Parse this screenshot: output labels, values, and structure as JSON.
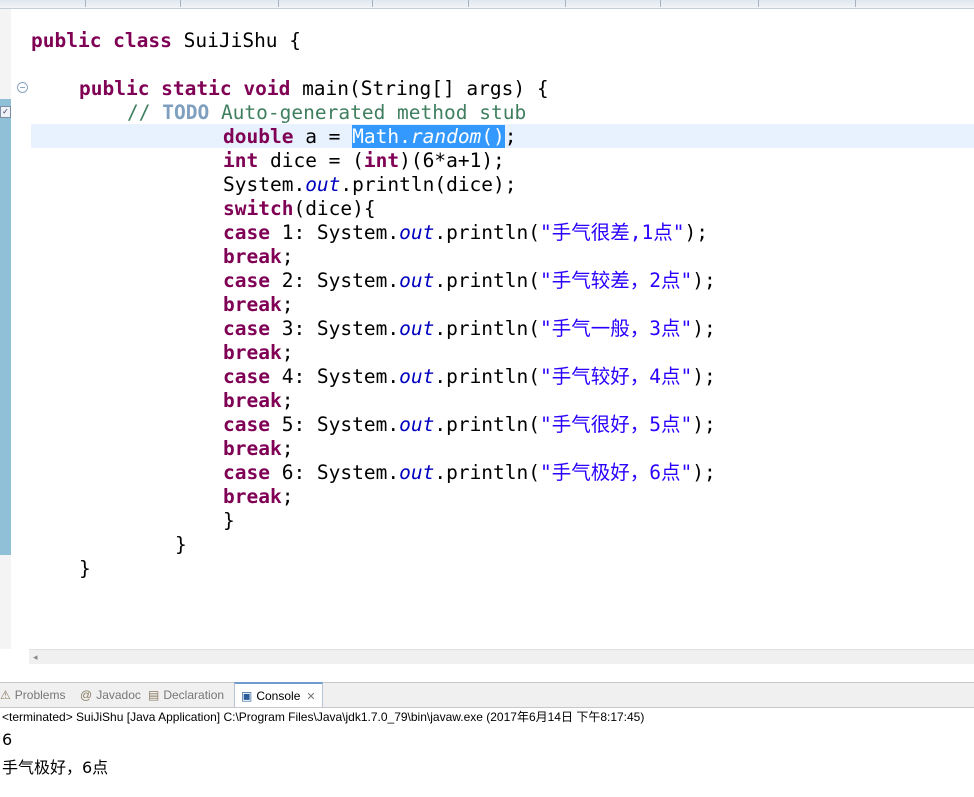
{
  "code": {
    "class_decl": {
      "kw": "public class",
      "rest": " SuiJiShu {"
    },
    "main_decl": {
      "kw": "public static void",
      "rest": " main(String[] args) {"
    },
    "comment": {
      "prefix": "// ",
      "todo": "TODO",
      "rest": " Auto-generated method stub"
    },
    "line_a": {
      "kw": "double",
      "mid": " a = ",
      "sel_a": "Math.",
      "sel_b": "random",
      "sel_c": "()",
      "end": ";"
    },
    "line_dice": {
      "kw": "int",
      "mid": " dice = (",
      "kw2": "int",
      "end": ")(6*a+1);"
    },
    "line_print": {
      "a": "System.",
      "fld": "out",
      "b": ".println(dice);"
    },
    "line_switch": {
      "kw": "switch",
      "rest": "(dice){"
    },
    "cases": [
      {
        "kw": "case",
        "label": " 1: System.",
        "fld": "out",
        "call": ".println(",
        "str": "\"手气很差,1点\"",
        "end": ");",
        "brk": "break",
        "semi": ";"
      },
      {
        "kw": "case",
        "label": " 2: System.",
        "fld": "out",
        "call": ".println(",
        "str": "\"手气较差，2点\"",
        "end": ");",
        "brk": "break",
        "semi": ";"
      },
      {
        "kw": "case",
        "label": " 3: System.",
        "fld": "out",
        "call": ".println(",
        "str": "\"手气一般，3点\"",
        "end": ");",
        "brk": "break",
        "semi": ";"
      },
      {
        "kw": "case",
        "label": " 4: System.",
        "fld": "out",
        "call": ".println(",
        "str": "\"手气较好，4点\"",
        "end": ");",
        "brk": "break",
        "semi": ";"
      },
      {
        "kw": "case",
        "label": " 5: System.",
        "fld": "out",
        "call": ".println(",
        "str": "\"手气很好，5点\"",
        "end": ");",
        "brk": "break",
        "semi": ";"
      },
      {
        "kw": "case",
        "label": " 6: System.",
        "fld": "out",
        "call": ".println(",
        "str": "\"手气极好，6点\"",
        "end": ");",
        "brk": "break",
        "semi": ";"
      }
    ],
    "brace": "}"
  },
  "view_tabs": {
    "problems": "Problems",
    "javadoc": "Javadoc",
    "declaration": "Declaration",
    "console": "Console",
    "close": "✕"
  },
  "console": {
    "status": "<terminated> SuiJiShu [Java Application] C:\\Program Files\\Java\\jdk1.7.0_79\\bin\\javaw.exe (2017年6月14日 下午8:17:45)",
    "output": [
      "6",
      "手气极好，6点"
    ]
  },
  "icons": {
    "fold": "minus-circle",
    "problems_icon": "warning-sheet",
    "javadoc_icon": "at-sign",
    "declaration_icon": "declaration-sheet",
    "console_icon": "monitor"
  },
  "colors": {
    "keyword": "#7f0055",
    "comment": "#3f7f5f",
    "string": "#2a00ff",
    "field": "#0000c0",
    "selection": "#3399ff",
    "current_line": "#e8f2fe"
  }
}
